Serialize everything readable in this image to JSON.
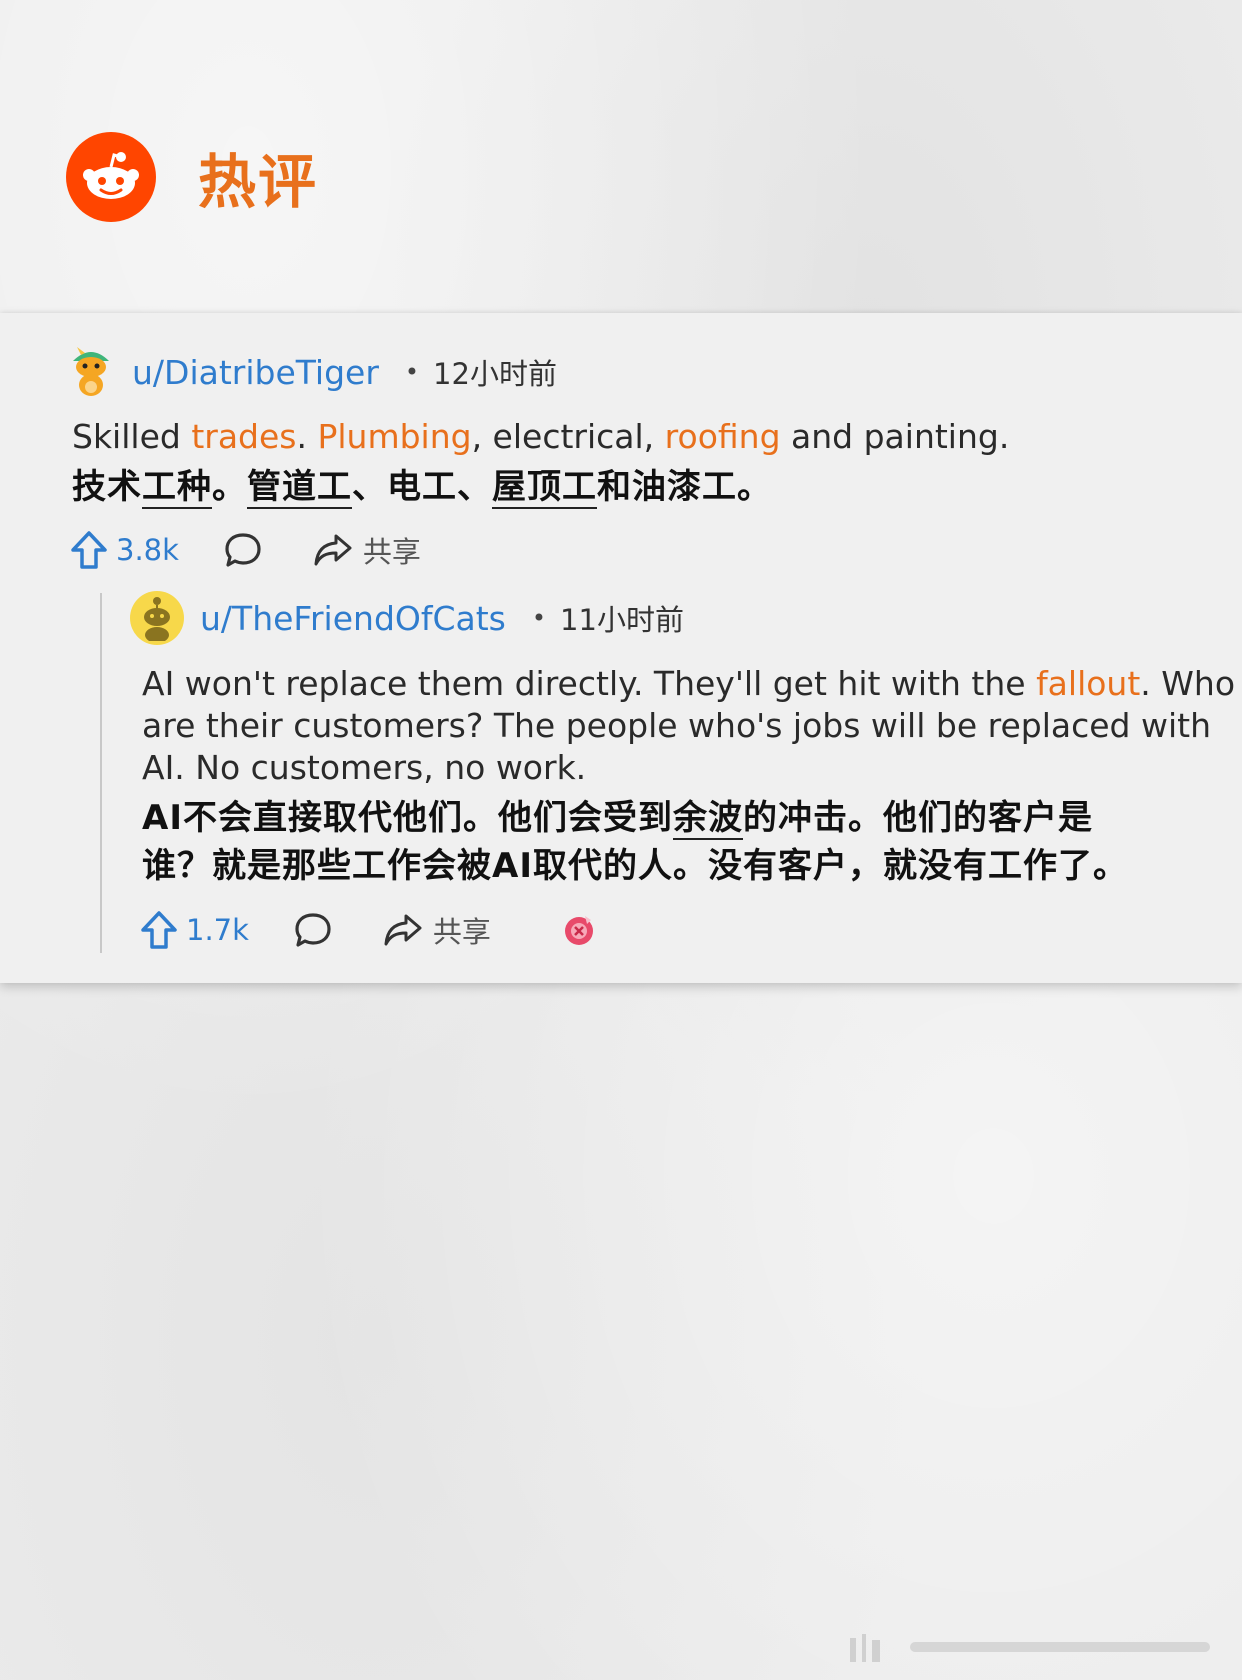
{
  "header": {
    "title": "热评"
  },
  "comments": [
    {
      "username": "u/DiatribeTiger",
      "dot": "•",
      "time": "12小时前",
      "en": {
        "p1": "Skilled ",
        "o1": "trades",
        "p2": ". ",
        "o2": "Plumbing",
        "p3": ", electrical, ",
        "o3": "roofing",
        "p4": " and painting."
      },
      "zh": {
        "a": "技术",
        "u1": "工种",
        "b": "。",
        "u2": "管道工",
        "c": "、电工、",
        "u3": "屋顶工",
        "d": "和油漆工。"
      },
      "upvotes": "3.8k",
      "share_label": "共享"
    },
    {
      "username": "u/TheFriendOfCats",
      "dot": "•",
      "time": "11小时前",
      "en": {
        "l1a": "AI won't replace them directly. They'll get hit with the ",
        "o1": "fallout",
        "l1b": ". Who",
        "l2": "are their customers? The people who's jobs will be replaced with",
        "l3": "AI. No customers, no work."
      },
      "zh": {
        "l1a": "AI不会直接取代他们。他们会受到",
        "u1": "余波",
        "l1b": "的冲击。他们的客户是",
        "l2": "谁？就是那些工作会被AI取代的人。没有客户，就没有工作了。"
      },
      "upvotes": "1.7k",
      "share_label": "共享"
    }
  ],
  "colors": {
    "accent_orange": "#e8701c",
    "reddit_orange": "#ff4500",
    "link_blue": "#2f7ccd"
  }
}
